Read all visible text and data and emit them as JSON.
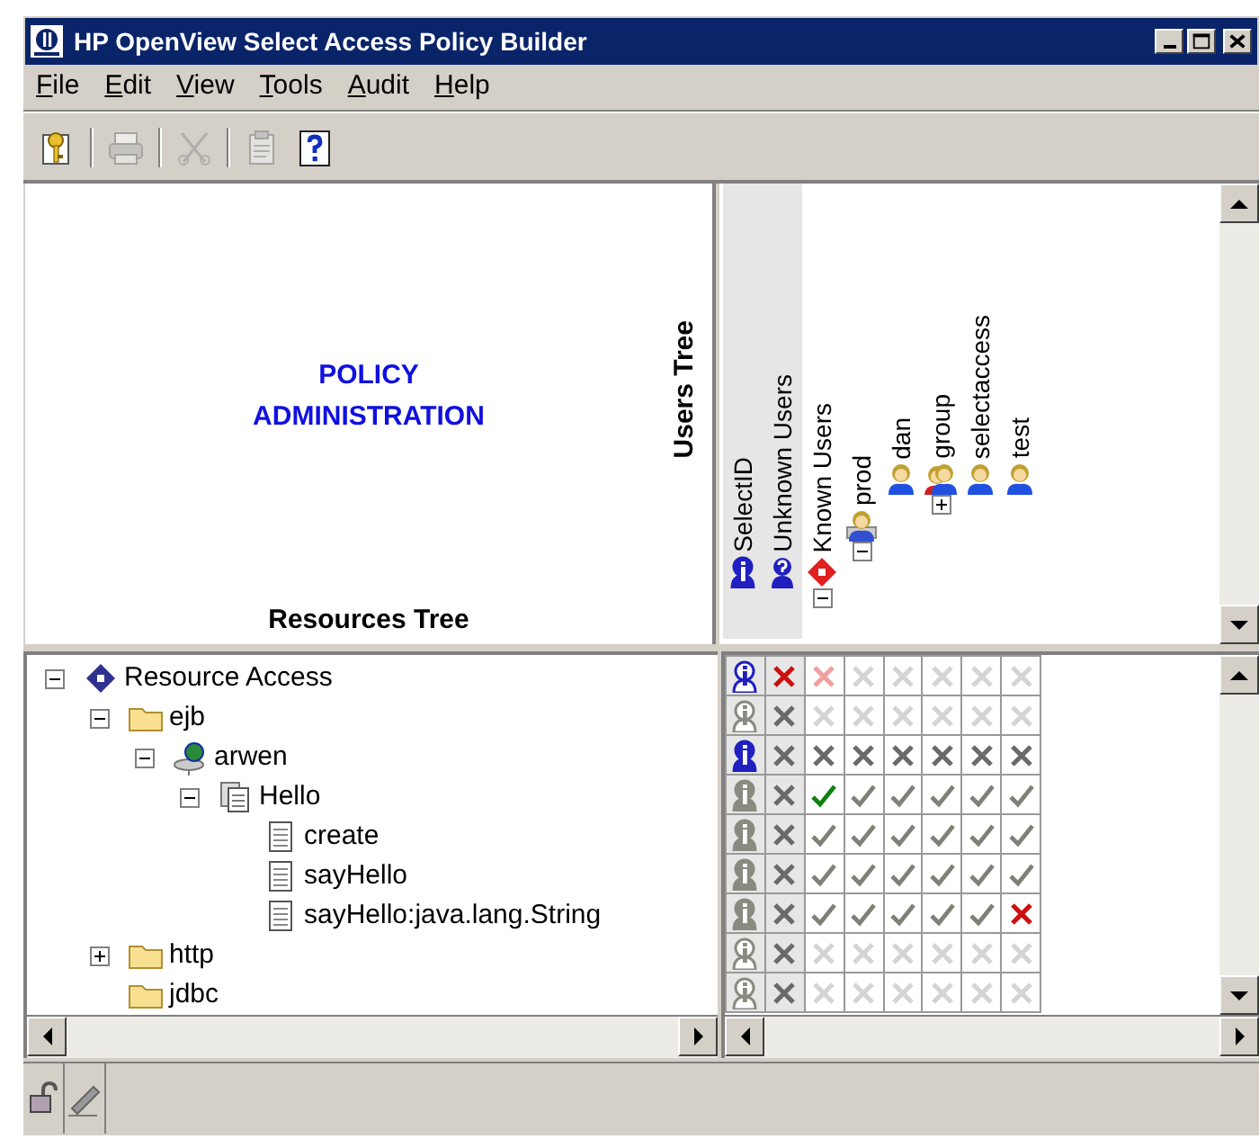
{
  "window": {
    "title": "HP OpenView Select Access Policy Builder"
  },
  "menu": [
    "File",
    "Edit",
    "View",
    "Tools",
    "Audit",
    "Help"
  ],
  "toolbar": [
    {
      "kind": "key",
      "disabled": false
    },
    {
      "kind": "printer",
      "disabled": true
    },
    {
      "kind": "scissors",
      "disabled": true
    },
    {
      "kind": "clipboard",
      "disabled": true
    },
    {
      "kind": "help",
      "disabled": false
    }
  ],
  "banner": [
    "POLICY",
    "ADMINISTRATION"
  ],
  "resources_tree_label": "Resources Tree",
  "users_tree_label": "Users Tree",
  "users_tree": [
    {
      "label": "SelectID",
      "kind": "selectid"
    },
    {
      "label": "Unknown Users",
      "kind": "unknown"
    },
    {
      "label": "Known Users",
      "kind": "known",
      "expanded": true,
      "children": [
        {
          "label": "prod",
          "kind": "container",
          "expanded": true,
          "children": [
            {
              "label": "dan",
              "kind": "user"
            },
            {
              "label": "group",
              "kind": "group",
              "expanded": false
            },
            {
              "label": "selectaccess",
              "kind": "user"
            },
            {
              "label": "test",
              "kind": "user"
            }
          ]
        }
      ]
    }
  ],
  "resource_tree": [
    {
      "label": "Resource Access",
      "kind": "root",
      "expanded": true,
      "children": [
        {
          "label": "ejb",
          "kind": "folder",
          "expanded": true,
          "children": [
            {
              "label": "arwen",
              "kind": "server",
              "expanded": true,
              "children": [
                {
                  "label": "Hello",
                  "kind": "class",
                  "expanded": true,
                  "children": [
                    {
                      "label": "create",
                      "kind": "method"
                    },
                    {
                      "label": "sayHello",
                      "kind": "method"
                    },
                    {
                      "label": "sayHello:java.lang.String",
                      "kind": "method"
                    }
                  ]
                }
              ]
            }
          ]
        },
        {
          "label": "http",
          "kind": "folder",
          "expanded": false
        },
        {
          "label": "jdbc",
          "kind": "folder"
        }
      ]
    }
  ],
  "access_matrix": {
    "rows": [
      {
        "cells": [
          {
            "kind": "id_outline_blue"
          },
          {
            "kind": "deny"
          },
          {
            "kind": "deny_faint"
          },
          {
            "kind": "none"
          },
          {
            "kind": "none"
          },
          {
            "kind": "none"
          },
          {
            "kind": "none"
          },
          {
            "kind": "none"
          }
        ]
      },
      {
        "cells": [
          {
            "kind": "id_outline_gray"
          },
          {
            "kind": "deny_gray"
          },
          {
            "kind": "none"
          },
          {
            "kind": "none"
          },
          {
            "kind": "none"
          },
          {
            "kind": "none"
          },
          {
            "kind": "none"
          },
          {
            "kind": "none"
          }
        ]
      },
      {
        "cells": [
          {
            "kind": "id_solid_blue"
          },
          {
            "kind": "deny_gray"
          },
          {
            "kind": "deny_gray"
          },
          {
            "kind": "deny_gray"
          },
          {
            "kind": "deny_gray"
          },
          {
            "kind": "deny_gray"
          },
          {
            "kind": "deny_gray"
          },
          {
            "kind": "deny_gray"
          }
        ]
      },
      {
        "cells": [
          {
            "kind": "id_solid_gray"
          },
          {
            "kind": "deny_gray"
          },
          {
            "kind": "allow"
          },
          {
            "kind": "allow_gray"
          },
          {
            "kind": "allow_gray"
          },
          {
            "kind": "allow_gray"
          },
          {
            "kind": "allow_gray"
          },
          {
            "kind": "allow_gray"
          }
        ]
      },
      {
        "cells": [
          {
            "kind": "id_solid_gray"
          },
          {
            "kind": "deny_gray"
          },
          {
            "kind": "allow_gray"
          },
          {
            "kind": "allow_gray"
          },
          {
            "kind": "allow_gray"
          },
          {
            "kind": "allow_gray"
          },
          {
            "kind": "allow_gray"
          },
          {
            "kind": "allow_gray"
          }
        ]
      },
      {
        "cells": [
          {
            "kind": "id_solid_gray"
          },
          {
            "kind": "deny_gray"
          },
          {
            "kind": "allow_gray"
          },
          {
            "kind": "allow_gray"
          },
          {
            "kind": "allow_gray"
          },
          {
            "kind": "allow_gray"
          },
          {
            "kind": "allow_gray"
          },
          {
            "kind": "allow_gray"
          }
        ]
      },
      {
        "cells": [
          {
            "kind": "id_solid_gray"
          },
          {
            "kind": "deny_gray"
          },
          {
            "kind": "allow_gray"
          },
          {
            "kind": "allow_gray"
          },
          {
            "kind": "allow_gray"
          },
          {
            "kind": "allow_gray"
          },
          {
            "kind": "allow_gray"
          },
          {
            "kind": "deny"
          }
        ]
      },
      {
        "cells": [
          {
            "kind": "id_outline_gray"
          },
          {
            "kind": "deny_gray"
          },
          {
            "kind": "none"
          },
          {
            "kind": "none"
          },
          {
            "kind": "none"
          },
          {
            "kind": "none"
          },
          {
            "kind": "none"
          },
          {
            "kind": "none"
          }
        ]
      },
      {
        "cells": [
          {
            "kind": "id_outline_gray"
          },
          {
            "kind": "deny_gray"
          },
          {
            "kind": "none"
          },
          {
            "kind": "none"
          },
          {
            "kind": "none"
          },
          {
            "kind": "none"
          },
          {
            "kind": "none"
          },
          {
            "kind": "none"
          }
        ]
      }
    ]
  },
  "status_bar": [
    {
      "kind": "lock"
    },
    {
      "kind": "pen"
    }
  ]
}
